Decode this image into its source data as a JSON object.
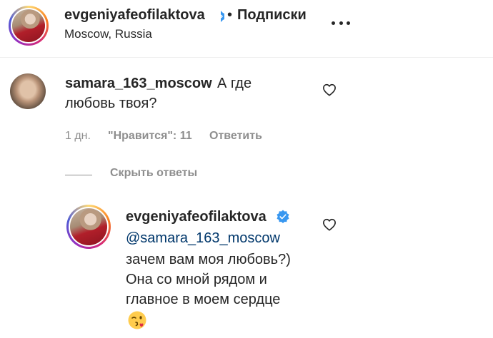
{
  "header": {
    "username": "evgeniyafeofilaktova",
    "separator": "•",
    "follow_label": "Подписки",
    "location": "Moscow, Russia"
  },
  "comment": {
    "username": "samara_163_moscow",
    "text_part1": "А где",
    "text_part2": "любовь твоя?",
    "time": "1 дн.",
    "likes": "\"Нравится\": 11",
    "reply_label": "Ответить",
    "hide_replies_label": "Скрыть ответы"
  },
  "reply": {
    "username": "evgeniyafeofilaktova",
    "mention": "@samara_163_moscow",
    "line1": "зачем вам моя любовь?)",
    "line2": "Она со мной рядом и",
    "line3": "главное в моем сердце"
  },
  "colors": {
    "text": "#262626",
    "secondary": "#8e8e8e",
    "link": "#00376b",
    "verified": "#3897f0"
  }
}
